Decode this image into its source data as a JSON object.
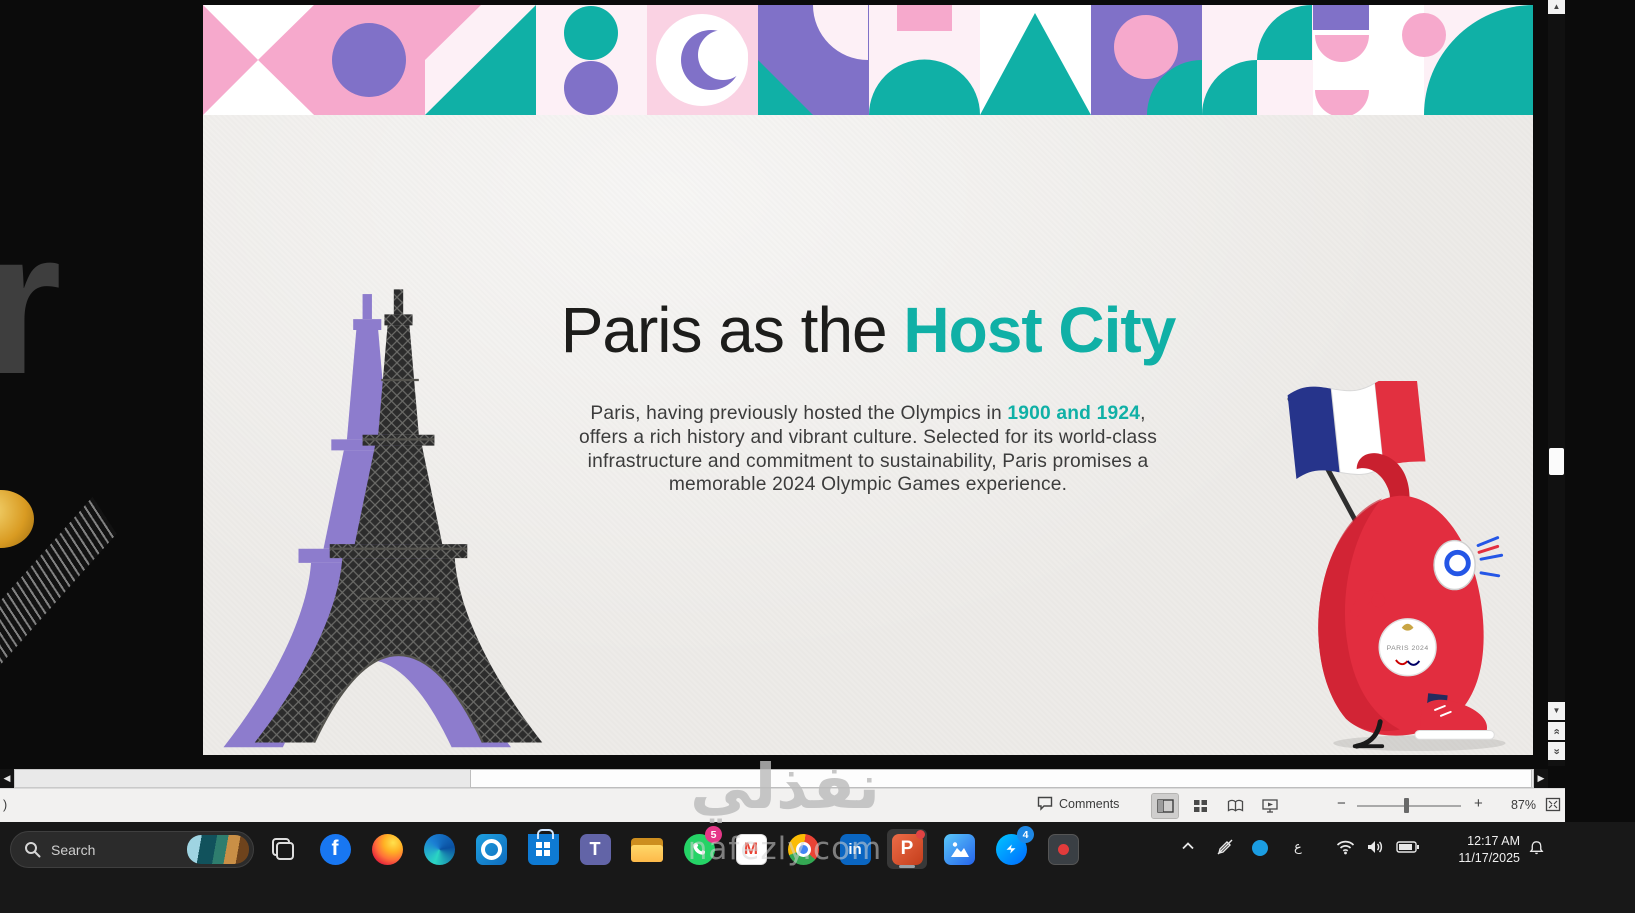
{
  "theme": {
    "teal": "#10B0A6",
    "purple": "#8071C8",
    "pink": "#F6A9CC",
    "pink_light": "#FAD2E3",
    "pink_pale": "#FDF0F6",
    "red": "#E22D3F",
    "slide_bg": "#EDEBE8",
    "taskbar_bg": "#181818",
    "status_bg": "#F2F1F0"
  },
  "background_fragments": {
    "letter": "r"
  },
  "slide": {
    "title": {
      "prefix": "Paris as the ",
      "accent": "Host City"
    },
    "body": {
      "part1": "Paris, having previously hosted the Olympics in ",
      "highlight": "1900 and 1924",
      "part2": ", offers a rich history and vibrant culture. Selected for its world-class infrastructure and commitment to sustainability, Paris promises a memorable 2024 Olympic Games experience."
    },
    "mascot_badge": "PARIS 2024"
  },
  "watermark": {
    "arabic": "نفذلي",
    "latin": "nafezly.com"
  },
  "statusbar": {
    "left_fragment": ")",
    "comments": "Comments",
    "views": [
      "normal",
      "slide-sorter",
      "reading-view",
      "slide-show"
    ],
    "zoom": "87%"
  },
  "taskbar": {
    "search": "Search",
    "apps": [
      "task-view",
      "facebook",
      "firefox",
      "edge",
      "outlook",
      "microsoft-store",
      "teams",
      "file-explorer",
      "whatsapp",
      "gmail",
      "chrome",
      "linkedin",
      "powerpoint",
      "photos",
      "messenger",
      "screen-recorder"
    ],
    "glyphs": {
      "facebook": "f",
      "teams": "T",
      "gmail": "M",
      "linkedin": "in",
      "powerpoint": "P"
    },
    "badges": {
      "whatsapp": "5",
      "messenger": "4"
    },
    "tray": {
      "language": "ع",
      "time": "12:17 AM",
      "date": "11/17/2025"
    }
  }
}
